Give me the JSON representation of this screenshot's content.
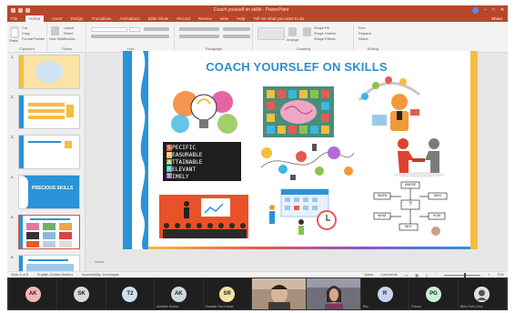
{
  "window": {
    "title": "Coach yourself on skills - PowerPoint",
    "user_name": "",
    "share_label": "Share"
  },
  "tabs": [
    "File",
    "Home",
    "Insert",
    "Design",
    "Transitions",
    "Animations",
    "Slide Show",
    "Record",
    "Review",
    "View",
    "Help"
  ],
  "tell_me": "Tell me what you want to do",
  "ribbon": {
    "groups": [
      "Clipboard",
      "Slides",
      "Font",
      "Paragraph",
      "Drawing",
      "Editing"
    ],
    "paste_label": "Paste",
    "cut": "Cut",
    "copy": "Copy",
    "format_painter": "Format Painter",
    "new_slide": "New Slide",
    "layout": "Layout",
    "reset": "Reset",
    "section": "Section",
    "find": "Find",
    "replace": "Replace",
    "select": "Select",
    "arrange": "Arrange",
    "quick_styles": "Quick Styles",
    "shape_fill": "Shape Fill",
    "shape_outline": "Shape Outline",
    "shape_effects": "Shape Effects"
  },
  "slides_panel": {
    "items": [
      {
        "num": "1",
        "accent": "#f5bd3f"
      },
      {
        "num": "2",
        "accent": "#2b93d8"
      },
      {
        "num": "3",
        "accent": "#f5bd3f"
      },
      {
        "num": "4",
        "accent": "#2b93d8",
        "text": "PRECIOUS SKILLS"
      },
      {
        "num": "5",
        "accent": "#2b93d8",
        "selected": true
      },
      {
        "num": "6",
        "accent": "#2b93d8"
      }
    ]
  },
  "slide": {
    "title": "COACH YOURSLEF ON SKILLS",
    "smart_lines": [
      "PECIFIC",
      "EASURABLE",
      "TTAINABLE",
      "ELEVANT",
      "IMELY"
    ],
    "smart_letters": [
      "S",
      "M",
      "A",
      "R",
      "T"
    ],
    "images": [
      "colorful-lightbulb",
      "brain-icons",
      "expert-character",
      "smart-goals",
      "idea-network",
      "handshake",
      "presentation-audience",
      "schedule-team",
      "flowchart-where-when-how"
    ],
    "flow_words": [
      "WHERE",
      "WHEN",
      "WHAT",
      "HOW",
      "WHO",
      "WHY"
    ]
  },
  "notes_label": "Notes",
  "status": {
    "slide_info": "Slide 5 of 8",
    "language": "English (United States)",
    "accessibility": "Accessibility: Investigate",
    "notes_btn": "Notes",
    "comments_btn": "Comments",
    "zoom": "70%"
  },
  "participants": [
    {
      "initials": "AK",
      "color": "#f4b6b6",
      "name": ""
    },
    {
      "initials": "SK",
      "color": "#d9d9d9",
      "name": ""
    },
    {
      "initials": "T2",
      "color": "#cfe0ef",
      "name": ""
    },
    {
      "initials": "AK",
      "color": "#cfd6dc",
      "name": "Akhilesh Kumar"
    },
    {
      "initials": "SR",
      "color": "#f1e3a6",
      "name": "Saurabh Rao Kamat"
    },
    {
      "initials": "",
      "video": true,
      "name": ""
    },
    {
      "initials": "",
      "video": true,
      "name": ""
    },
    {
      "initials": "R",
      "color": "#c9d3f0",
      "name": "Ritu"
    },
    {
      "initials": "PG",
      "color": "#c7efd7",
      "name": "Pranav"
    },
    {
      "initials": "",
      "color": "#e0e0e0",
      "name": "Mirko Cuki (You)"
    }
  ]
}
